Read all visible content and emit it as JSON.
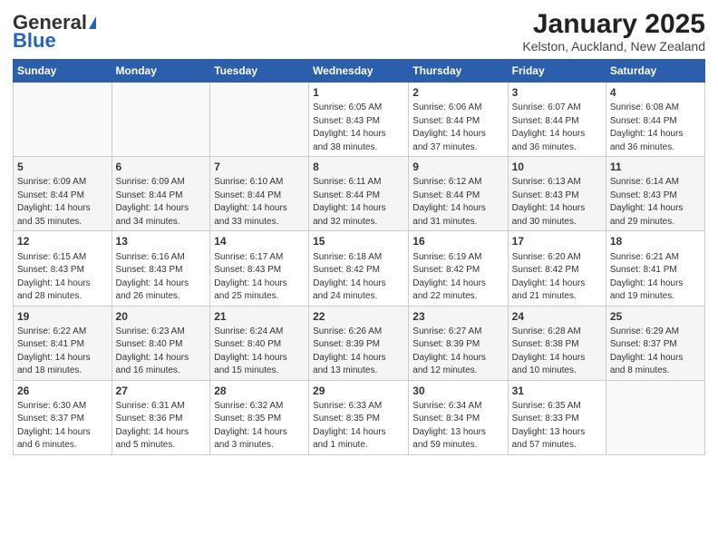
{
  "logo": {
    "general": "General",
    "blue": "Blue"
  },
  "title": "January 2025",
  "subtitle": "Kelston, Auckland, New Zealand",
  "days_of_week": [
    "Sunday",
    "Monday",
    "Tuesday",
    "Wednesday",
    "Thursday",
    "Friday",
    "Saturday"
  ],
  "weeks": [
    [
      {
        "day": "",
        "info": ""
      },
      {
        "day": "",
        "info": ""
      },
      {
        "day": "",
        "info": ""
      },
      {
        "day": "1",
        "info": "Sunrise: 6:05 AM\nSunset: 8:43 PM\nDaylight: 14 hours\nand 38 minutes."
      },
      {
        "day": "2",
        "info": "Sunrise: 6:06 AM\nSunset: 8:44 PM\nDaylight: 14 hours\nand 37 minutes."
      },
      {
        "day": "3",
        "info": "Sunrise: 6:07 AM\nSunset: 8:44 PM\nDaylight: 14 hours\nand 36 minutes."
      },
      {
        "day": "4",
        "info": "Sunrise: 6:08 AM\nSunset: 8:44 PM\nDaylight: 14 hours\nand 36 minutes."
      }
    ],
    [
      {
        "day": "5",
        "info": "Sunrise: 6:09 AM\nSunset: 8:44 PM\nDaylight: 14 hours\nand 35 minutes."
      },
      {
        "day": "6",
        "info": "Sunrise: 6:09 AM\nSunset: 8:44 PM\nDaylight: 14 hours\nand 34 minutes."
      },
      {
        "day": "7",
        "info": "Sunrise: 6:10 AM\nSunset: 8:44 PM\nDaylight: 14 hours\nand 33 minutes."
      },
      {
        "day": "8",
        "info": "Sunrise: 6:11 AM\nSunset: 8:44 PM\nDaylight: 14 hours\nand 32 minutes."
      },
      {
        "day": "9",
        "info": "Sunrise: 6:12 AM\nSunset: 8:44 PM\nDaylight: 14 hours\nand 31 minutes."
      },
      {
        "day": "10",
        "info": "Sunrise: 6:13 AM\nSunset: 8:43 PM\nDaylight: 14 hours\nand 30 minutes."
      },
      {
        "day": "11",
        "info": "Sunrise: 6:14 AM\nSunset: 8:43 PM\nDaylight: 14 hours\nand 29 minutes."
      }
    ],
    [
      {
        "day": "12",
        "info": "Sunrise: 6:15 AM\nSunset: 8:43 PM\nDaylight: 14 hours\nand 28 minutes."
      },
      {
        "day": "13",
        "info": "Sunrise: 6:16 AM\nSunset: 8:43 PM\nDaylight: 14 hours\nand 26 minutes."
      },
      {
        "day": "14",
        "info": "Sunrise: 6:17 AM\nSunset: 8:43 PM\nDaylight: 14 hours\nand 25 minutes."
      },
      {
        "day": "15",
        "info": "Sunrise: 6:18 AM\nSunset: 8:42 PM\nDaylight: 14 hours\nand 24 minutes."
      },
      {
        "day": "16",
        "info": "Sunrise: 6:19 AM\nSunset: 8:42 PM\nDaylight: 14 hours\nand 22 minutes."
      },
      {
        "day": "17",
        "info": "Sunrise: 6:20 AM\nSunset: 8:42 PM\nDaylight: 14 hours\nand 21 minutes."
      },
      {
        "day": "18",
        "info": "Sunrise: 6:21 AM\nSunset: 8:41 PM\nDaylight: 14 hours\nand 19 minutes."
      }
    ],
    [
      {
        "day": "19",
        "info": "Sunrise: 6:22 AM\nSunset: 8:41 PM\nDaylight: 14 hours\nand 18 minutes."
      },
      {
        "day": "20",
        "info": "Sunrise: 6:23 AM\nSunset: 8:40 PM\nDaylight: 14 hours\nand 16 minutes."
      },
      {
        "day": "21",
        "info": "Sunrise: 6:24 AM\nSunset: 8:40 PM\nDaylight: 14 hours\nand 15 minutes."
      },
      {
        "day": "22",
        "info": "Sunrise: 6:26 AM\nSunset: 8:39 PM\nDaylight: 14 hours\nand 13 minutes."
      },
      {
        "day": "23",
        "info": "Sunrise: 6:27 AM\nSunset: 8:39 PM\nDaylight: 14 hours\nand 12 minutes."
      },
      {
        "day": "24",
        "info": "Sunrise: 6:28 AM\nSunset: 8:38 PM\nDaylight: 14 hours\nand 10 minutes."
      },
      {
        "day": "25",
        "info": "Sunrise: 6:29 AM\nSunset: 8:37 PM\nDaylight: 14 hours\nand 8 minutes."
      }
    ],
    [
      {
        "day": "26",
        "info": "Sunrise: 6:30 AM\nSunset: 8:37 PM\nDaylight: 14 hours\nand 6 minutes."
      },
      {
        "day": "27",
        "info": "Sunrise: 6:31 AM\nSunset: 8:36 PM\nDaylight: 14 hours\nand 5 minutes."
      },
      {
        "day": "28",
        "info": "Sunrise: 6:32 AM\nSunset: 8:35 PM\nDaylight: 14 hours\nand 3 minutes."
      },
      {
        "day": "29",
        "info": "Sunrise: 6:33 AM\nSunset: 8:35 PM\nDaylight: 14 hours\nand 1 minute."
      },
      {
        "day": "30",
        "info": "Sunrise: 6:34 AM\nSunset: 8:34 PM\nDaylight: 13 hours\nand 59 minutes."
      },
      {
        "day": "31",
        "info": "Sunrise: 6:35 AM\nSunset: 8:33 PM\nDaylight: 13 hours\nand 57 minutes."
      },
      {
        "day": "",
        "info": ""
      }
    ]
  ]
}
